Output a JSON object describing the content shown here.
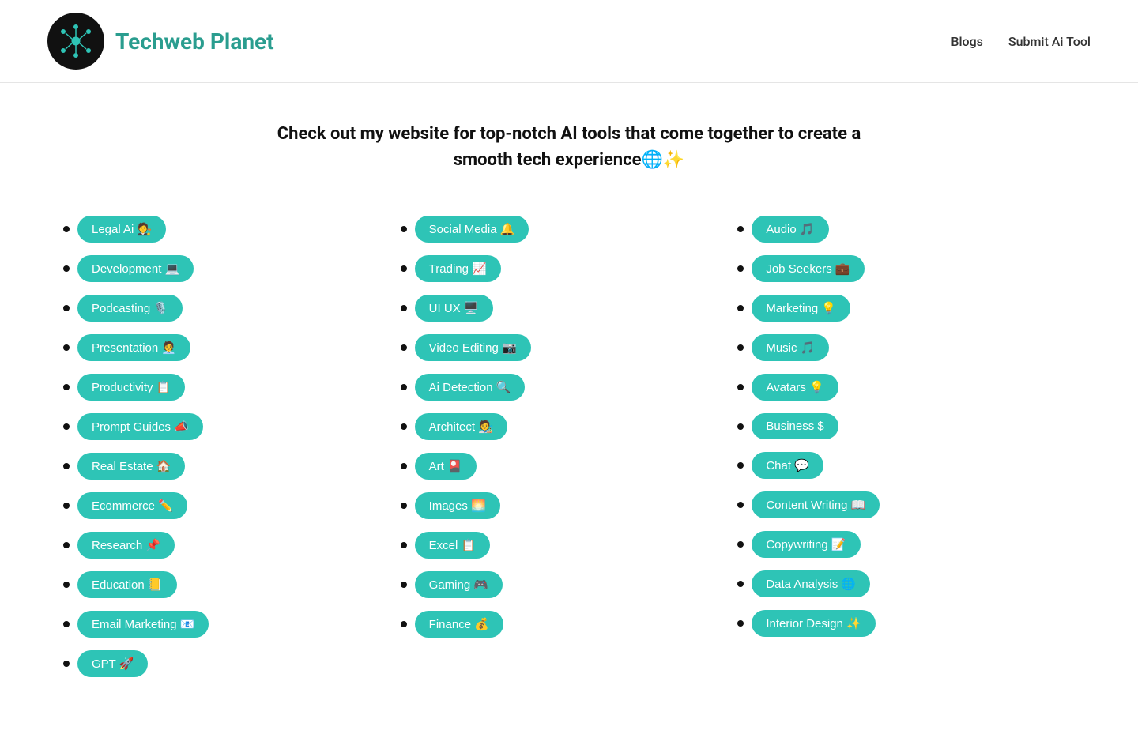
{
  "header": {
    "logo_alt": "Techweb Planet logo",
    "site_name": "Techweb Planet",
    "nav": [
      {
        "label": "Blogs",
        "href": "#"
      },
      {
        "label": "Submit Ai Tool",
        "href": "#"
      }
    ]
  },
  "hero": {
    "headline": "Check out my website for top-notch AI tools that come together to create a smooth tech experience🌐✨"
  },
  "columns": [
    {
      "id": "col1",
      "items": [
        {
          "label": "Legal Ai 🧑‍⚖️"
        },
        {
          "label": "Development 💻"
        },
        {
          "label": "Podcasting 🎙️"
        },
        {
          "label": "Presentation 🧑‍💼"
        },
        {
          "label": "Productivity 📋"
        },
        {
          "label": "Prompt Guides 📣"
        },
        {
          "label": "Real Estate 🏠"
        },
        {
          "label": "Ecommerce ✏️"
        },
        {
          "label": "Research 📌"
        },
        {
          "label": "Education 📒"
        },
        {
          "label": "Email Marketing 📧"
        },
        {
          "label": "GPT 🚀"
        }
      ]
    },
    {
      "id": "col2",
      "items": [
        {
          "label": "Social Media 🔔"
        },
        {
          "label": "Trading 📈"
        },
        {
          "label": "UI UX 🖥️"
        },
        {
          "label": "Video Editing 📷"
        },
        {
          "label": "Ai Detection 🔍"
        },
        {
          "label": "Architect 🧑‍🎨"
        },
        {
          "label": "Art 🎴"
        },
        {
          "label": "Images 🌅"
        },
        {
          "label": "Excel 📋"
        },
        {
          "label": "Gaming 🎮"
        },
        {
          "label": "Finance 💰"
        }
      ]
    },
    {
      "id": "col3",
      "items": [
        {
          "label": "Audio 🎵"
        },
        {
          "label": "Job Seekers 💼"
        },
        {
          "label": "Marketing 💡"
        },
        {
          "label": "Music 🎵"
        },
        {
          "label": "Avatars 💡"
        },
        {
          "label": "Business $"
        },
        {
          "label": "Chat 💬"
        },
        {
          "label": "Content Writing 📖"
        },
        {
          "label": "Copywriting 📝"
        },
        {
          "label": "Data Analysis 🌐"
        },
        {
          "label": "Interior Design ✨"
        }
      ]
    }
  ]
}
